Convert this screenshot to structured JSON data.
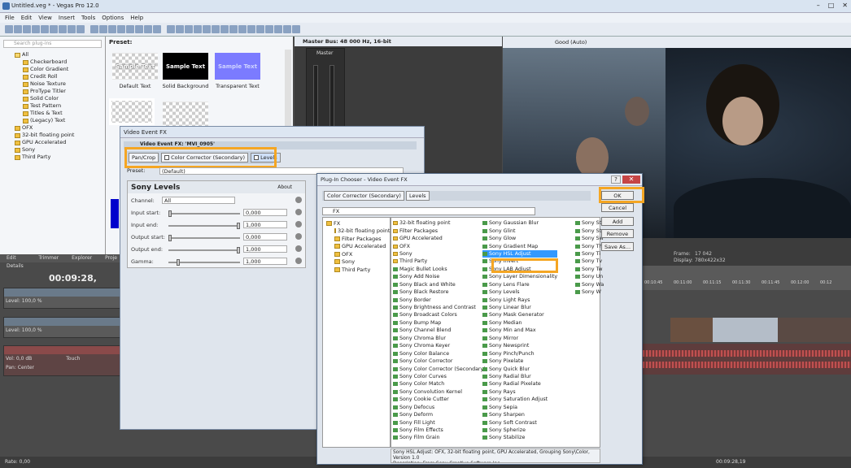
{
  "window": {
    "title": "Untitled.veg * - Vegas Pro 12.0",
    "controls": [
      "–",
      "□",
      "✕"
    ]
  },
  "menu": [
    "File",
    "Edit",
    "View",
    "Insert",
    "Tools",
    "Options",
    "Help"
  ],
  "media_gen": {
    "search_placeholder": "Search plug-ins",
    "tree": [
      {
        "label": "All",
        "depth": 0
      },
      {
        "label": "Checkerboard",
        "depth": 1
      },
      {
        "label": "Color Gradient",
        "depth": 1
      },
      {
        "label": "Credit Roll",
        "depth": 1
      },
      {
        "label": "Noise Texture",
        "depth": 1
      },
      {
        "label": "ProType Titler",
        "depth": 1
      },
      {
        "label": "Solid Color",
        "depth": 1
      },
      {
        "label": "Test Pattern",
        "depth": 1
      },
      {
        "label": "Titles & Text",
        "depth": 1
      },
      {
        "label": "(Legacy) Text",
        "depth": 1
      },
      {
        "label": "OFX",
        "depth": 0
      },
      {
        "label": "32-bit floating point",
        "depth": 0
      },
      {
        "label": "GPU Accelerated",
        "depth": 0
      },
      {
        "label": "Sony",
        "depth": 0
      },
      {
        "label": "Third Party",
        "depth": 0
      }
    ],
    "preset_label": "Preset:",
    "thumbs": [
      {
        "text": "Sample Text",
        "label": "Default Text"
      },
      {
        "text": "Sample Text",
        "label": "Solid Background"
      },
      {
        "text": "Sample Text",
        "label": "Transparent Text"
      }
    ]
  },
  "master": {
    "title": "Master Bus: 48 000 Hz, 16-bit",
    "label": "Master"
  },
  "preview": {
    "quality": "Good (Auto)",
    "frame_label": "Frame:",
    "frame_value": "17 042",
    "display_label": "Display:",
    "display_value": "780x422x32"
  },
  "tabs": [
    "Edit Details",
    "Trimmer",
    "Explorer",
    "Proje"
  ],
  "timeline": {
    "time": "00:09:28,",
    "ruler": [
      "00:10:45",
      "00:11:00",
      "00:11:15",
      "00:11:30",
      "00:11:45",
      "00:12:00",
      "00:12"
    ],
    "tracks": [
      {
        "label": "Level: 100,0 %"
      },
      {
        "label": "Level: 100,0 %"
      },
      {
        "vol": "Vol:",
        "vol_val": "0,0 dB",
        "pan": "Pan:",
        "pan_val": "Center",
        "touch": "Touch"
      }
    ],
    "rate": "Rate: 0,00",
    "end_time": "00:09:28,19"
  },
  "vfx": {
    "title": "Video Event FX",
    "chain": [
      "Pan/Crop",
      "Color Corrector (Secondary)",
      "Levels"
    ],
    "chain_header": "Video Event FX: 'MVI_0905'",
    "preset_label": "Preset:",
    "preset_value": "(Default)",
    "plugin_name": "Sony Levels",
    "about": "About",
    "params": [
      {
        "name": "Channel:",
        "value": "All"
      },
      {
        "name": "Input start:",
        "value": "0,000"
      },
      {
        "name": "Input end:",
        "value": "1,000"
      },
      {
        "name": "Output start:",
        "value": "0,000"
      },
      {
        "name": "Output end:",
        "value": "1,000"
      },
      {
        "name": "Gamma:",
        "value": "1,000"
      }
    ]
  },
  "chooser": {
    "title": "Plug-In Chooser - Video Event FX",
    "help": "?",
    "close": "✕",
    "chain": [
      "Color Corrector (Secondary)",
      "Levels"
    ],
    "path": "FX",
    "tree": [
      {
        "label": "FX",
        "depth": 0
      },
      {
        "label": "32-bit floating point",
        "depth": 1
      },
      {
        "label": "Filter Packages",
        "depth": 1
      },
      {
        "label": "GPU Accelerated",
        "depth": 1
      },
      {
        "label": "OFX",
        "depth": 1
      },
      {
        "label": "Sony",
        "depth": 1
      },
      {
        "label": "Third Party",
        "depth": 1
      }
    ],
    "col1": [
      "32-bit floating point",
      "Filter Packages",
      "GPU Accelerated",
      "OFX",
      "Sony",
      "Third Party",
      "Magic Bullet Looks",
      "Sony Add Noise",
      "Sony Black and White",
      "Sony Black Restore",
      "Sony Border",
      "Sony Brightness and Contrast",
      "Sony Broadcast Colors",
      "Sony Bump Map",
      "Sony Channel Blend",
      "Sony Chroma Blur",
      "Sony Chroma Keyer",
      "Sony Color Balance",
      "Sony Color Corrector",
      "Sony Color Corrector (Secondary)",
      "Sony Color Curves",
      "Sony Color Match",
      "Sony Convolution Kernel",
      "Sony Cookie Cutter",
      "Sony Defocus",
      "Sony Deform",
      "Sony Fill Light",
      "Sony Film Effects",
      "Sony Film Grain"
    ],
    "col2": [
      "Sony Gaussian Blur",
      "Sony Glint",
      "Sony Glow",
      "Sony Gradient Map",
      "Sony HSL Adjust",
      "Sony Invert",
      "Sony LAB Adjust",
      "Sony Layer Dimensionality",
      "Sony Lens Flare",
      "Sony Levels",
      "Sony Light Rays",
      "Sony Linear Blur",
      "Sony Mask Generator",
      "Sony Median",
      "Sony Min and Max",
      "Sony Mirror",
      "Sony Newsprint",
      "Sony Pinch/Punch",
      "Sony Pixelate",
      "Sony Quick Blur",
      "Sony Radial Blur",
      "Sony Radial Pixelate",
      "Sony Rays",
      "Sony Saturation Adjust",
      "Sony Sepia",
      "Sony Sharpen",
      "Sony Soft Contrast",
      "Sony Spherize",
      "Sony Stabilize"
    ],
    "col3": [
      "Sony St",
      "Sony St",
      "Sony Sw",
      "Sony Th",
      "Sony Ti",
      "Sony Tv",
      "Sony Tw",
      "Sony Un",
      "Sony Wa",
      "Sony W"
    ],
    "selected": "Sony HSL Adjust",
    "buttons": [
      "OK",
      "Cancel",
      "Add",
      "Remove",
      "Save As..."
    ],
    "description": "Sony HSL Adjust: OFX, 32-bit floating point, GPU Accelerated, Grouping Sony\\Color, Version 1.0\nDescription: From Sony Creative Software Inc."
  }
}
